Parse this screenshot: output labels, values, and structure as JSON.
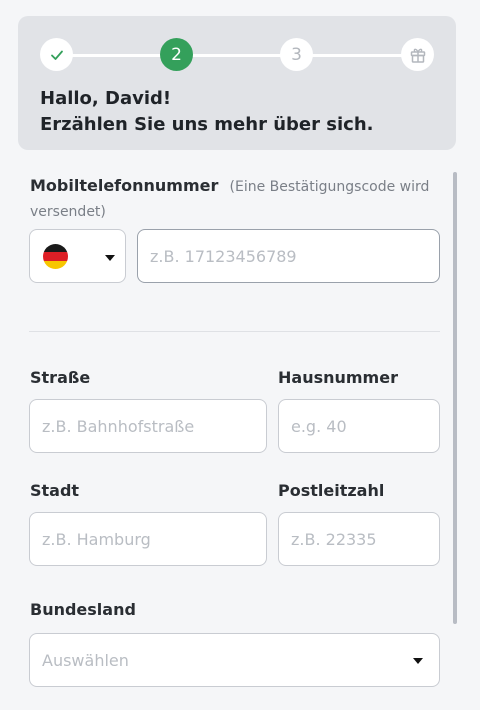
{
  "stepper": {
    "steps": [
      {
        "label": "✓",
        "state": "done"
      },
      {
        "label": "2",
        "state": "active"
      },
      {
        "label": "3",
        "state": "pending"
      },
      {
        "label": "",
        "icon": "gift-icon",
        "state": "pending"
      }
    ],
    "active_color": "#34a05b"
  },
  "greeting": {
    "line1": "Hallo, David!",
    "line2": "Erzählen Sie uns mehr über sich."
  },
  "phone": {
    "label": "Mobiltelefonnummer",
    "hint": "(Eine Bestätigungscode wird versendet)",
    "country_flag": "germany-flag-icon",
    "placeholder": "z.B. 17123456789"
  },
  "address": {
    "street_label": "Straße",
    "street_placeholder": "z.B. Bahnhofstraße",
    "house_label": "Hausnummer",
    "house_placeholder": "e.g. 40",
    "city_label": "Stadt",
    "city_placeholder": "z.B. Hamburg",
    "zip_label": "Postleitzahl",
    "zip_placeholder": "z.B. 22335",
    "state_label": "Bundesland",
    "state_placeholder": "Auswählen"
  }
}
